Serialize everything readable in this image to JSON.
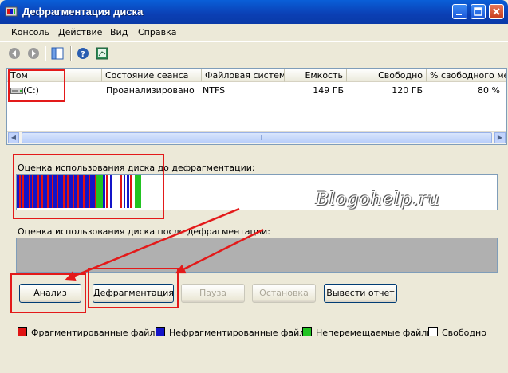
{
  "window": {
    "title": "Дефрагментация диска"
  },
  "menu": {
    "items": [
      {
        "label": "Консоль"
      },
      {
        "label": "Действие"
      },
      {
        "label": "Вид"
      },
      {
        "label": "Справка"
      }
    ]
  },
  "table": {
    "columns": [
      "Том",
      "Состояние сеанса",
      "Файловая система",
      "Емкость",
      "Свободно",
      "% свободного мест"
    ],
    "rows": [
      {
        "volume": "(C:)",
        "status": "Проанализировано",
        "fs": "NTFS",
        "capacity": "149 ГБ",
        "free": "120 ГБ",
        "free_pct": "80 %"
      }
    ]
  },
  "before": {
    "label": "Оценка использования диска до дефрагментации:"
  },
  "after": {
    "label": "Оценка использования диска после дефрагментации:"
  },
  "buttons": {
    "analyze": "Анализ",
    "defrag": "Дефрагментация",
    "pause": "Пауза",
    "stop": "Остановка",
    "report": "Вывести отчет"
  },
  "legend": [
    {
      "label": "Фрагментированные файлы",
      "color": "#e01414"
    },
    {
      "label": "Нефрагментированные файлы",
      "color": "#1414c8"
    },
    {
      "label": "Неперемещаемые файлы",
      "color": "#22c322"
    },
    {
      "label": "Свободно",
      "color": "#ffffff"
    }
  ],
  "watermark": "Blogohelp.ru",
  "colors": {
    "annotation": "#e31a1a",
    "titlebar": "#0a5fd8"
  }
}
